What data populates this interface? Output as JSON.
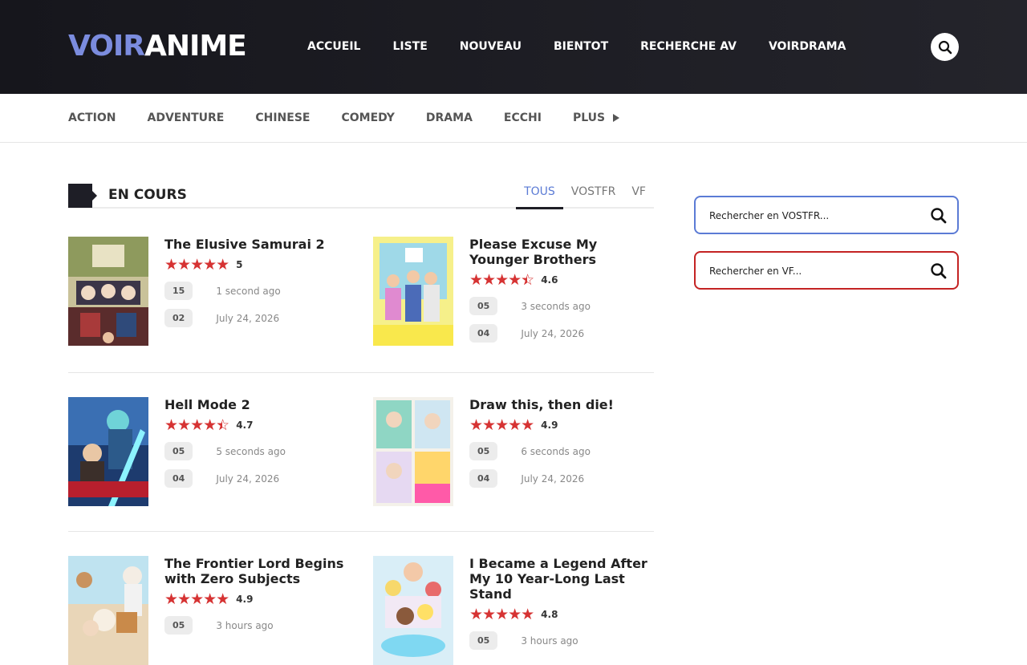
{
  "header": {
    "logo_part1": "VOIR",
    "logo_part2": "ANIME",
    "nav": [
      "ACCUEIL",
      "LISTE",
      "NOUVEAU",
      "BIENTOT",
      "RECHERCHE AV",
      "VOIRDRAMA"
    ]
  },
  "genres": [
    "ACTION",
    "ADVENTURE",
    "CHINESE",
    "COMEDY",
    "DRAMA",
    "ECCHI",
    "PLUS"
  ],
  "section": {
    "title": "EN COURS",
    "tabs": [
      "TOUS",
      "VOSTFR",
      "VF"
    ],
    "active_tab": "TOUS"
  },
  "colors": {
    "accent_blue": "#5b7bd5",
    "accent_red": "#c42323",
    "star_red": "#d63333",
    "header_dark": "#1b1b22"
  },
  "cards": [
    {
      "title": "The Elusive Samurai 2",
      "rating": 5,
      "score": "5",
      "ep1": "15",
      "time1": "1 second ago",
      "ep2": "02",
      "time2": "July 24, 2026"
    },
    {
      "title": "Please Excuse My Younger Brothers",
      "rating": 4.6,
      "score": "4.6",
      "ep1": "05",
      "time1": "3 seconds ago",
      "ep2": "04",
      "time2": "July 24, 2026"
    },
    {
      "title": "Hell Mode 2",
      "rating": 4.7,
      "score": "4.7",
      "ep1": "05",
      "time1": "5 seconds ago",
      "ep2": "04",
      "time2": "July 24, 2026"
    },
    {
      "title": "Draw this, then die!",
      "rating": 4.9,
      "score": "4.9",
      "ep1": "05",
      "time1": "6 seconds ago",
      "ep2": "04",
      "time2": "July 24, 2026"
    },
    {
      "title": "The Frontier Lord Begins with Zero Subjects",
      "rating": 4.9,
      "score": "4.9",
      "ep1": "05",
      "time1": "3 hours ago"
    },
    {
      "title": "I Became a Legend After My 10 Year-Long Last Stand",
      "rating": 4.8,
      "score": "4.8",
      "ep1": "05",
      "time1": "3 hours ago"
    }
  ],
  "sidebar": {
    "search_vostfr_placeholder": "Rechercher en VOSTFR...",
    "search_vf_placeholder": "Rechercher en VF..."
  }
}
